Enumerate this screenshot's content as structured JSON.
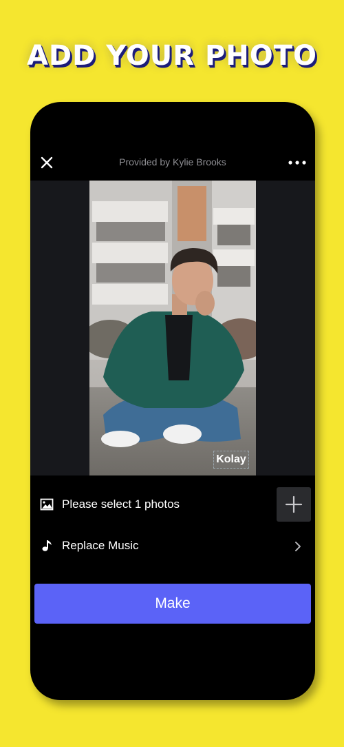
{
  "headline": "ADD YOUR PHOTO",
  "header": {
    "provided_by": "Provided by Kylie Brooks",
    "close_icon": "close-icon",
    "more_icon": "more-dots-icon"
  },
  "preview": {
    "watermark": "Kolay"
  },
  "rows": {
    "photos": {
      "label": "Please select 1 photos",
      "icon": "image-icon",
      "action_icon": "plus-icon"
    },
    "music": {
      "label": "Replace Music",
      "icon": "music-note-icon",
      "action_icon": "chevron-right-icon"
    }
  },
  "make_button": {
    "label": "Make"
  },
  "colors": {
    "background": "#f5e62f",
    "phone": "#000000",
    "accent": "#5b63f7",
    "headline_shadow": "#1c1d7a"
  }
}
